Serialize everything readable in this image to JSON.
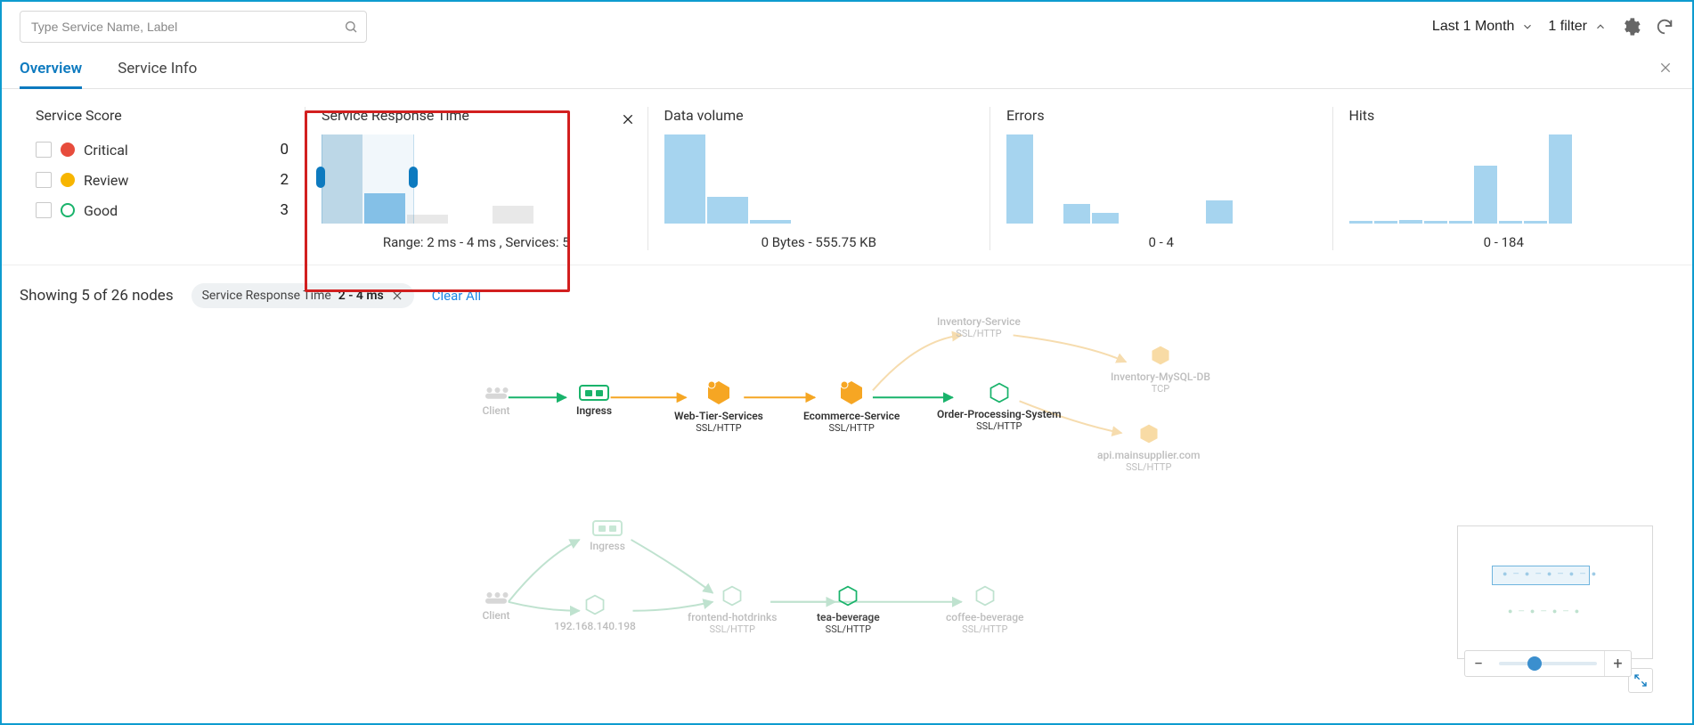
{
  "search": {
    "placeholder": "Type Service Name, Label"
  },
  "timerange": "Last 1 Month",
  "filter_label": "1 filter",
  "tabs": {
    "overview": "Overview",
    "service_info": "Service Info"
  },
  "score": {
    "title": "Service Score",
    "items": [
      {
        "label": "Critical",
        "count": "0"
      },
      {
        "label": "Review",
        "count": "2"
      },
      {
        "label": "Good",
        "count": "3"
      }
    ]
  },
  "card_srt": {
    "title": "Service Response Time",
    "range": "Range: 2 ms - 4 ms , Services: 5"
  },
  "card_dv": {
    "title": "Data volume",
    "range": "0 Bytes - 555.75 KB"
  },
  "card_err": {
    "title": "Errors",
    "range": "0 - 4"
  },
  "card_hits": {
    "title": "Hits",
    "range": "0 - 184"
  },
  "chart_data": [
    {
      "type": "bar",
      "id": "service_response_time",
      "title": "Service Response Time",
      "values": [
        100,
        34,
        10,
        0,
        20
      ],
      "style": [
        "sel",
        "blue",
        "grey",
        "grey",
        "grey"
      ],
      "selected_range_bars": [
        0,
        1
      ],
      "xlabel": "",
      "ylabel": ""
    },
    {
      "type": "bar",
      "id": "data_volume",
      "title": "Data volume",
      "values": [
        100,
        30,
        4,
        0,
        0
      ],
      "xlabel": "",
      "ylabel": ""
    },
    {
      "type": "bar",
      "id": "errors",
      "title": "Errors",
      "values": [
        100,
        0,
        22,
        12,
        0,
        0,
        0,
        26
      ],
      "xlabel": "",
      "ylabel": ""
    },
    {
      "type": "bar",
      "id": "hits",
      "title": "Hits",
      "values": [
        3,
        3,
        4,
        3,
        3,
        65,
        3,
        3,
        100
      ],
      "xlabel": "",
      "ylabel": ""
    }
  ],
  "showing": "Showing 5 of 26 nodes",
  "chip": {
    "label": "Service Response Time",
    "value": "2 - 4 ms"
  },
  "clear_all": "Clear All",
  "nodes": {
    "client": {
      "label": "Client"
    },
    "ingress": {
      "label": "Ingress"
    },
    "web_tier": {
      "label": "Web-Tier-Services",
      "sub": "SSL/HTTP"
    },
    "ecommerce": {
      "label": "Ecommerce-Service",
      "sub": "SSL/HTTP"
    },
    "ops": {
      "label": "Order-Processing-System",
      "sub": "SSL/HTTP"
    },
    "inventory": {
      "label": "Inventory-Service",
      "sub": "SSL/HTTP"
    },
    "inv_mysql": {
      "label": "Inventory-MySQL-DB",
      "sub": "TCP"
    },
    "supplier": {
      "label": "api.mainsupplier.com",
      "sub": "SSL/HTTP"
    },
    "client2": {
      "label": "Client"
    },
    "ingress2": {
      "label": "Ingress"
    },
    "ip": {
      "label": "192.168.140.198"
    },
    "frontend": {
      "label": "frontend-hotdrinks",
      "sub": "SSL/HTTP"
    },
    "tea": {
      "label": "tea-beverage",
      "sub": "SSL/HTTP"
    },
    "coffee": {
      "label": "coffee-beverage",
      "sub": "SSL/HTTP"
    }
  }
}
